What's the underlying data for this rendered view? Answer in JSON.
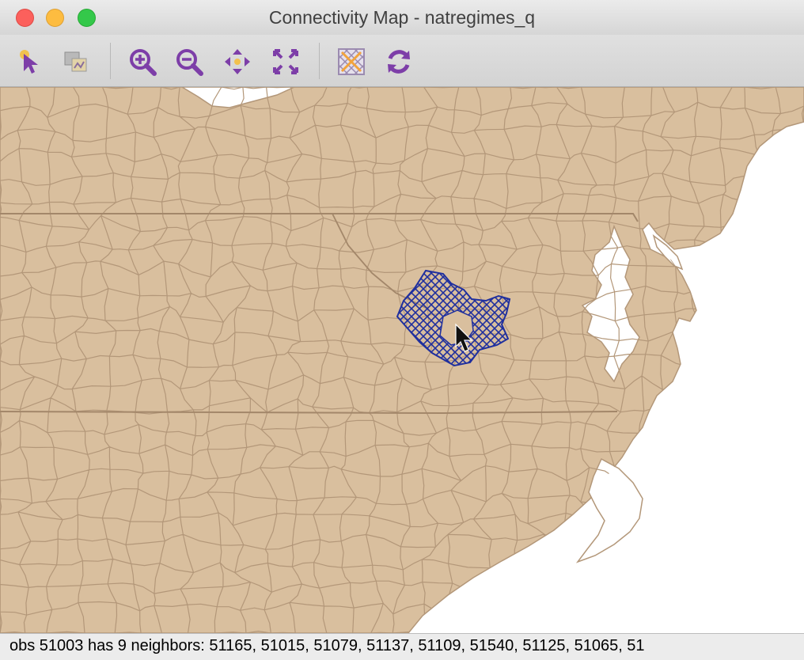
{
  "window": {
    "title": "Connectivity Map - natregimes_q"
  },
  "toolbar": {
    "tools": [
      {
        "name": "select-tool-icon"
      },
      {
        "name": "copy-image-icon"
      },
      {
        "name": "zoom-in-icon"
      },
      {
        "name": "zoom-out-icon"
      },
      {
        "name": "pan-icon"
      },
      {
        "name": "fit-to-window-icon"
      },
      {
        "name": "map-options-icon"
      },
      {
        "name": "refresh-icon"
      }
    ]
  },
  "map": {
    "land_color": "#d9bf9e",
    "border_color": "#b39779",
    "highlight_color": "#1f2f9e",
    "background_color": "#ffffff"
  },
  "status": {
    "text": "obs 51003 has 9 neighbors: 51165, 51015, 51079, 51137, 51109, 51540, 51125, 51065, 51"
  }
}
